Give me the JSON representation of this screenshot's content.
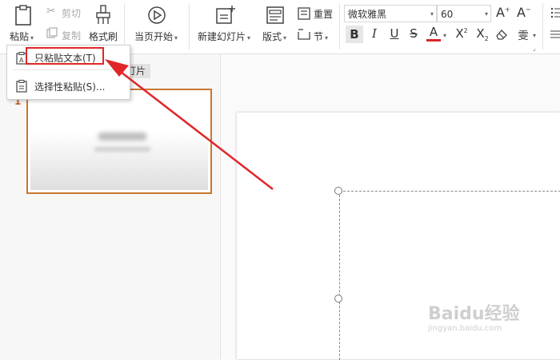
{
  "ribbon": {
    "paste_label": "粘贴",
    "cut_label": "剪切",
    "copy_label": "复制",
    "format_painter_label": "格式刷",
    "from_current_label": "当页开始",
    "new_slide_label": "新建幻灯片",
    "layout_label": "版式",
    "reset_label": "重置",
    "section_label": "节",
    "font_name": "微软雅黑",
    "font_size": "60"
  },
  "paste_menu": {
    "items": [
      {
        "label": "只粘贴文本(T)"
      },
      {
        "label": "选择性粘贴(S)..."
      }
    ]
  },
  "panel": {
    "tab_label": "灯片",
    "slide_number": "1"
  },
  "watermark": {
    "brand": "Baidu经验",
    "url": "jingyan.baidu.com"
  },
  "colors": {
    "highlight_red": "#e0262a",
    "thumbnail_border": "#c9762f",
    "font_color_underline": "#d9262a"
  }
}
